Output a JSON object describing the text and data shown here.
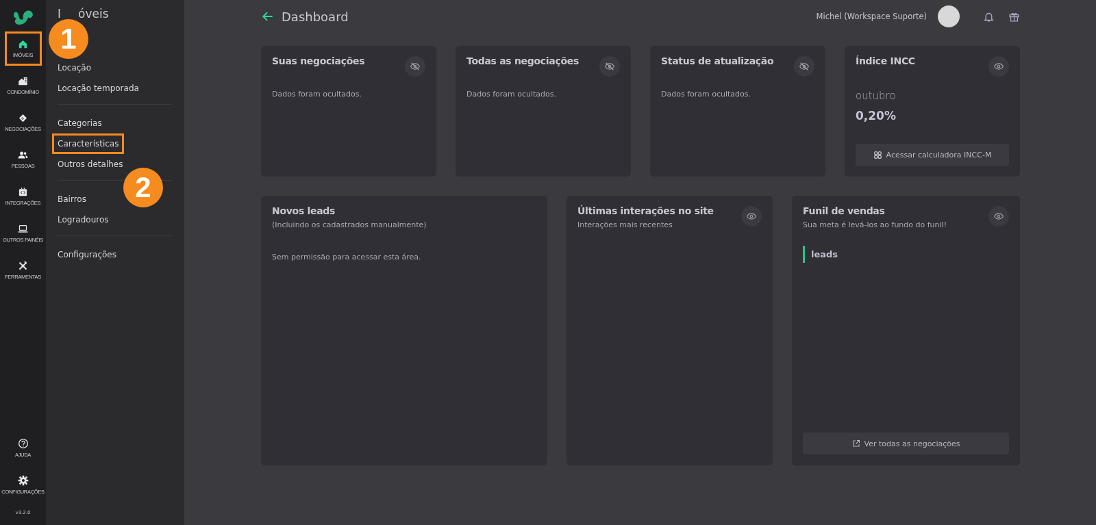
{
  "rail": {
    "items": [
      {
        "label": "IMÓVEIS",
        "selected": true,
        "highlighted": true
      },
      {
        "label": "CONDOMÍNIO",
        "selected": false,
        "highlighted": false
      },
      {
        "label": "NEGOCIAÇÕES",
        "selected": false,
        "highlighted": false
      },
      {
        "label": "PESSOAS",
        "selected": false,
        "highlighted": false
      },
      {
        "label": "INTEGRAÇÕES",
        "selected": false,
        "highlighted": false
      },
      {
        "label": "OUTROS PAINÉIS",
        "selected": false,
        "highlighted": false
      },
      {
        "label": "FERRAMENTAS",
        "selected": false,
        "highlighted": false
      }
    ],
    "bottom_items": [
      {
        "label": "AJUDA"
      },
      {
        "label": "CONFIGURAÇÕES"
      }
    ],
    "version": "v3.2.0"
  },
  "submenu": {
    "title_parts": [
      "I",
      "óveis"
    ],
    "groups": [
      [
        {
          "label": "Locação",
          "highlighted": false
        },
        {
          "label": "Locação temporada",
          "highlighted": false
        }
      ],
      [
        {
          "label": "Categorias",
          "highlighted": false
        },
        {
          "label": "Características",
          "highlighted": true
        },
        {
          "label": "Outros detalhes",
          "highlighted": false
        }
      ],
      [
        {
          "label": "Bairros",
          "highlighted": false
        },
        {
          "label": "Logradouros",
          "highlighted": false
        }
      ],
      [
        {
          "label": "Configurações",
          "highlighted": false
        }
      ]
    ]
  },
  "annotations": [
    {
      "number": "1"
    },
    {
      "number": "2"
    }
  ],
  "header": {
    "title": "Dashboard",
    "user": "Michel (Workspace Suporte)"
  },
  "cards": [
    {
      "kind": "hidden",
      "title": "Suas negociações",
      "hidden": true,
      "message": "Dados foram ocultados."
    },
    {
      "kind": "hidden",
      "title": "Todas as negociações",
      "hidden": true,
      "message": "Dados foram ocultados."
    },
    {
      "kind": "hidden",
      "title": "Status de atualização",
      "hidden": true,
      "message": "Dados foram ocultados."
    },
    {
      "kind": "incc",
      "title": "Índice INCC",
      "hidden": false,
      "month": "outubro",
      "value": "0,20%",
      "button": "Acessar calculadora INCC-M"
    },
    {
      "kind": "leads",
      "title": "Novos leads",
      "subtitle": "(Incluindo os cadastrados manualmente)",
      "message": "Sem permissão para acessar esta área."
    },
    {
      "kind": "interactions",
      "title": "Últimas interações no site",
      "hidden": false,
      "subtitle": "Interações mais recentes"
    },
    {
      "kind": "funnel",
      "title": "Funil de vendas",
      "hidden": false,
      "subtitle": "Sua meta é levá-los ao fundo do funil!",
      "stages": [
        {
          "label": "leads"
        }
      ],
      "button": "Ver todas as negociações"
    }
  ]
}
